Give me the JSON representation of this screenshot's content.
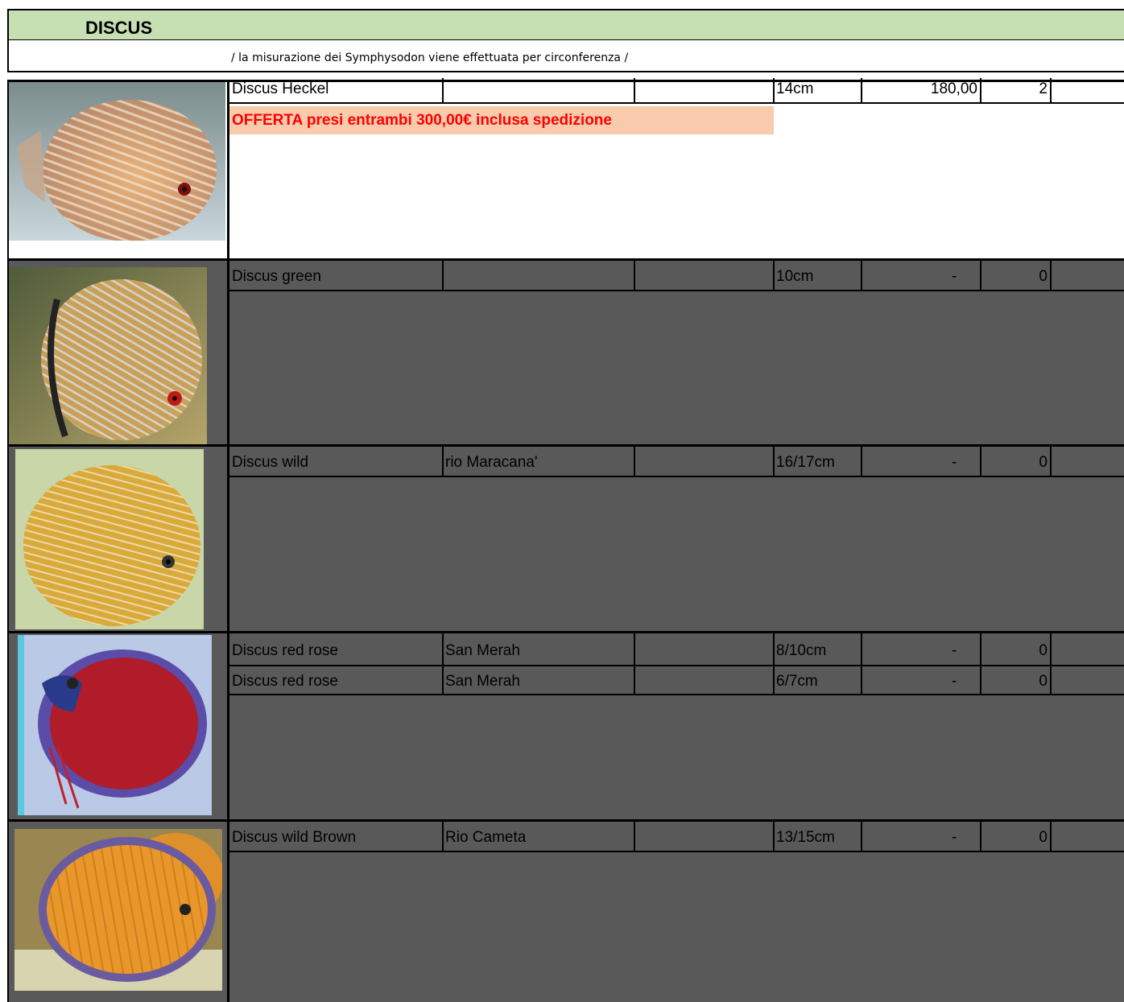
{
  "title": "DISCUS",
  "note": "/ la misurazione dei Symphysodon viene effettuata per circonferenza /",
  "offer": "OFFERTA presi entrambi 300,00€ inclusa spedizione",
  "rows": [
    {
      "name": "Discus Heckel",
      "origin": "",
      "extra": "",
      "size": "14cm",
      "price": "180,00",
      "qty": "2"
    },
    {
      "name": "Discus green",
      "origin": "",
      "extra": "",
      "size": "10cm",
      "price": "-",
      "qty": "0"
    },
    {
      "name": "Discus wild",
      "origin": "rio Maracana'",
      "extra": "",
      "size": "16/17cm",
      "price": "-",
      "qty": "0"
    },
    {
      "name": "Discus red rose",
      "origin": "San Merah",
      "extra": "",
      "size": "8/10cm",
      "price": "-",
      "qty": "0"
    },
    {
      "name": "Discus red rose",
      "origin": "San Merah",
      "extra": "",
      "size": "6/7cm",
      "price": "-",
      "qty": "0"
    },
    {
      "name": "Discus wild Brown",
      "origin": "Rio Cameta",
      "extra": "",
      "size": "13/15cm",
      "price": "-",
      "qty": "0"
    }
  ],
  "colors": {
    "header_bg": "#c6e0b4",
    "offer_bg": "#f8cbad",
    "offer_text": "#ff0000",
    "section_gray": "#595959"
  },
  "images": [
    "discus-heckel-photo",
    "discus-green-photo",
    "discus-wild-photo",
    "discus-red-rose-photo",
    "discus-wild-brown-photo"
  ]
}
